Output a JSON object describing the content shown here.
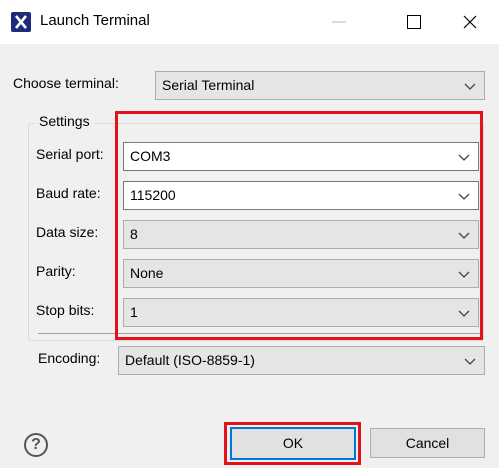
{
  "window": {
    "title": "Launch Terminal",
    "controls": [
      "minimize",
      "maximize",
      "close"
    ]
  },
  "choose_terminal": {
    "label": "Choose terminal:",
    "value": "Serial Terminal"
  },
  "settings": {
    "group_label": "Settings",
    "fields": [
      {
        "label": "Serial port:",
        "value": "COM3",
        "editable": true
      },
      {
        "label": "Baud rate:",
        "value": "115200",
        "editable": true
      },
      {
        "label": "Data size:",
        "value": "8",
        "editable": false
      },
      {
        "label": "Parity:",
        "value": "None",
        "editable": false
      },
      {
        "label": "Stop bits:",
        "value": "1",
        "editable": false
      }
    ]
  },
  "encoding": {
    "label": "Encoding:",
    "value": "Default (ISO-8859-1)"
  },
  "buttons": {
    "ok": "OK",
    "cancel": "Cancel",
    "help": "?"
  },
  "colors": {
    "highlight": "#e3131b",
    "focus": "#0078d7",
    "app_icon": "#1f2a7a"
  }
}
